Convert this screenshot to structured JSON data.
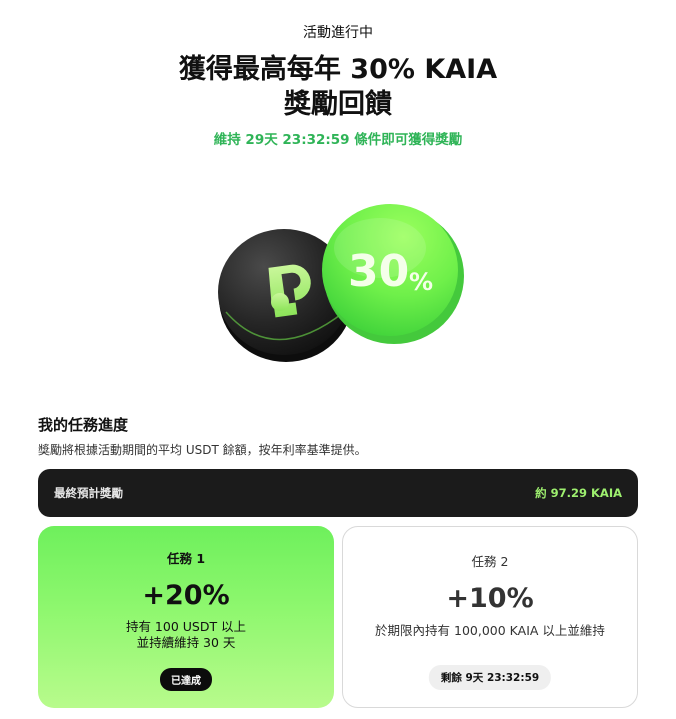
{
  "header": {
    "status": "活動進行中",
    "headline_line1": "獲得最高每年 30% KAIA",
    "headline_line2": "獎勵回饋",
    "countdown_prefix": "維持 ",
    "countdown_days": "29天",
    "countdown_time": " 23:32:59",
    "countdown_suffix": " 條件即可獲得獎勵"
  },
  "hero": {
    "coin_dark_icon": "kaia-logo-icon",
    "coin_green_text": "30",
    "coin_green_percent": "%",
    "colors": {
      "dark_coin": "#262626",
      "green_coin": "#6ff04a",
      "logo_green": "#a6ef72"
    }
  },
  "progress": {
    "title": "我的任務進度",
    "description": "獎勵將根據活動期間的平均 USDT 餘額，按年利率基準提供。",
    "summary_label": "最終預計獎勵",
    "summary_value": "約 97.29 KAIA"
  },
  "tasks": [
    {
      "title": "任務 1",
      "reward": "+20%",
      "desc_line1": "持有 100 USDT 以上",
      "desc_line2": "並持續維持 30 天",
      "badge": "已達成"
    },
    {
      "title": "任務 2",
      "reward": "+10%",
      "desc_line1": "於期限內持有 100,000 KAIA 以上並維持",
      "badge_prefix": "剩餘 ",
      "badge_days": "9天",
      "badge_time": " 23:32:59"
    }
  ],
  "colors": {
    "accent_green": "#2fb457",
    "summary_value": "#9ef06f",
    "summary_bg": "#1b1b1b"
  }
}
